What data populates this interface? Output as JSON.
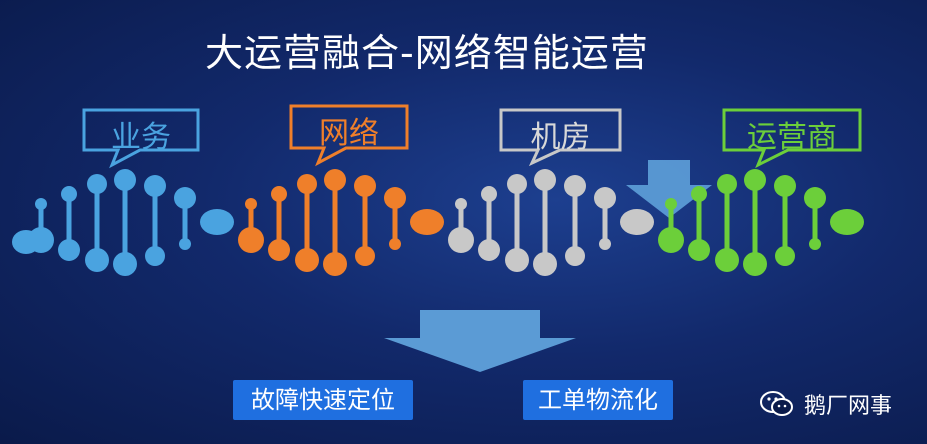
{
  "title": "大运营融合-网络智能运营",
  "callouts": [
    {
      "label": "业务",
      "color": "#4aa3e0"
    },
    {
      "label": "网络",
      "color": "#ef7f2a"
    },
    {
      "label": "机房",
      "color": "#c8c8c8"
    },
    {
      "label": "运营商",
      "color": "#6ccf3a"
    }
  ],
  "results": [
    {
      "label": "故障快速定位"
    },
    {
      "label": "工单物流化"
    }
  ],
  "brand": {
    "name": "鹅厂网事",
    "icon": "wechat-icon"
  },
  "colors": {
    "arrow": "#5b9bd5",
    "box": "#1f6fe0"
  }
}
